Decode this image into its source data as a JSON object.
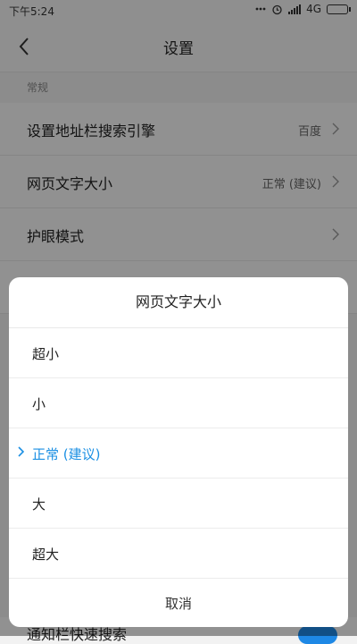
{
  "status_bar": {
    "time": "下午5:24",
    "network": "4G"
  },
  "header": {
    "title": "设置"
  },
  "settings": {
    "section": "常规",
    "rows": [
      {
        "label": "设置地址栏搜索引擎",
        "value": "百度"
      },
      {
        "label": "网页文字大小",
        "value": "正常 (建议)"
      },
      {
        "label": "护眼模式",
        "value": ""
      }
    ],
    "bottom_row": {
      "label": "通知栏快速搜索"
    }
  },
  "dialog": {
    "title": "网页文字大小",
    "options": [
      {
        "label": "超小",
        "selected": false
      },
      {
        "label": "小",
        "selected": false
      },
      {
        "label": "正常 (建议)",
        "selected": true
      },
      {
        "label": "大",
        "selected": false
      },
      {
        "label": "超大",
        "selected": false
      }
    ],
    "cancel_label": "取消"
  },
  "colors": {
    "accent": "#1a8fe3",
    "toggle_on": "#1e88e5"
  }
}
